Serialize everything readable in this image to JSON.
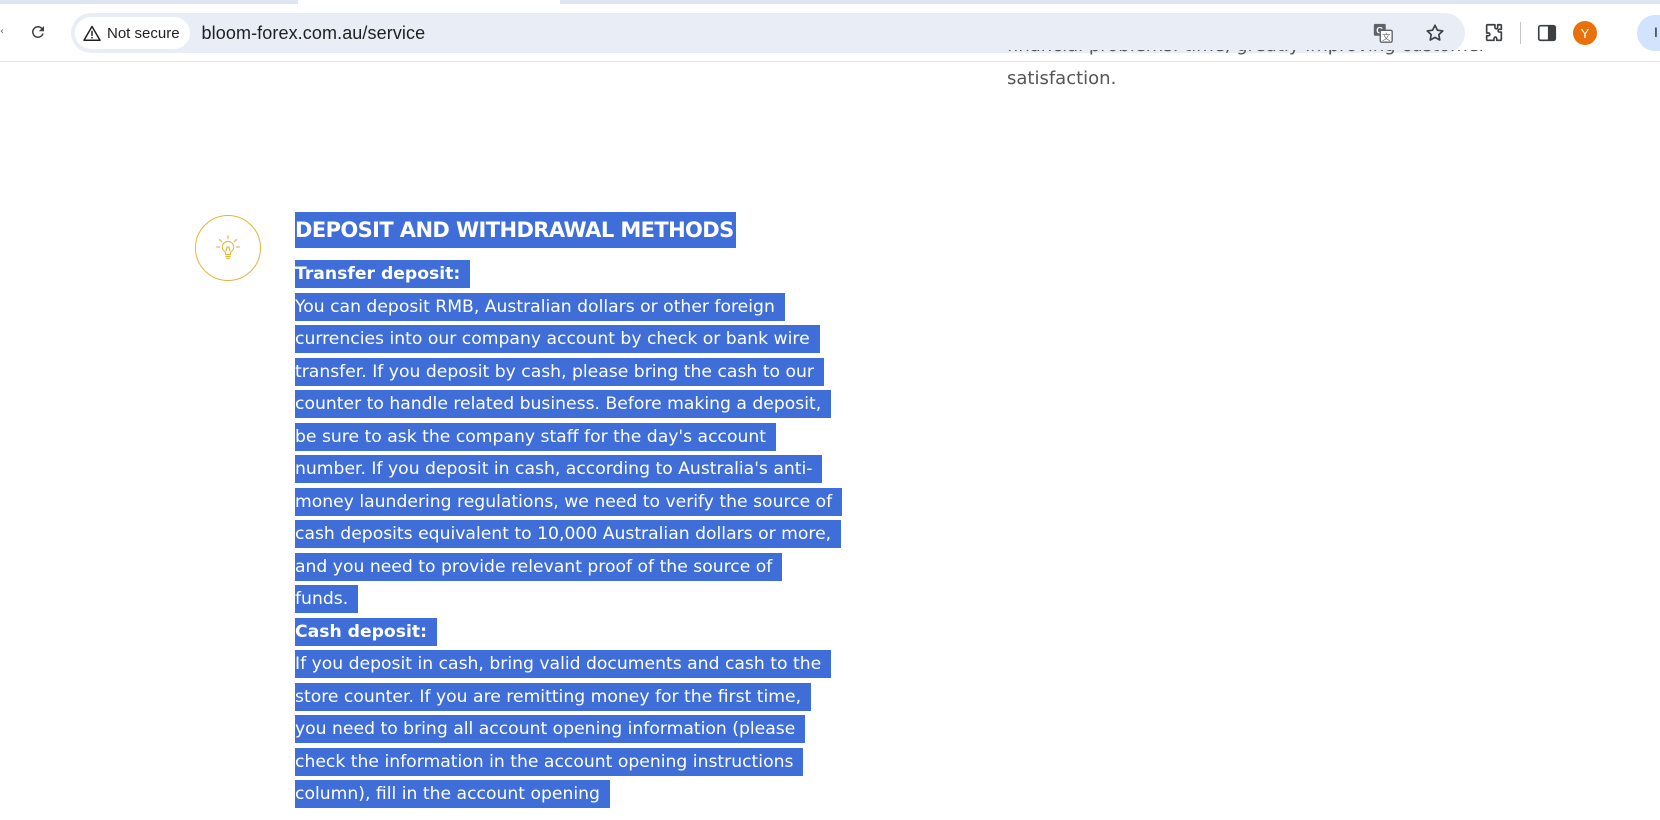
{
  "browser": {
    "security_label": "Not secure",
    "url": "bloom-forex.com.au/service",
    "profile_initial": "Y",
    "profile_pill_text": "I"
  },
  "page": {
    "previous_text": {
      "line1_partial": "financial problems. time, greatly improving customer",
      "line2": "satisfaction."
    },
    "section": {
      "title": "DEPOSIT AND WITHDRAWAL METHODS",
      "transfer_heading": "Transfer deposit:",
      "transfer_body": "You can deposit RMB, Australian dollars or other foreign currencies into our company account by check or bank wire transfer. If you deposit by cash, please bring the cash to our counter to handle related business. Before making a deposit, be sure to ask the company staff for the day's account number. If you deposit in cash, according to Australia's anti-money laundering regulations, we need to verify the source of cash deposits equivalent to 10,000 Australian dollars or more, and you need to provide relevant proof of the source of funds.",
      "cash_heading": "Cash deposit:",
      "cash_body": "If you deposit in cash, bring valid documents and cash to the store counter. If you are remitting money for the first time, you need to bring all account opening information (please check the information in the account opening instructions column), fill in the account opening"
    }
  },
  "colors": {
    "selection": "#3f6ed8",
    "icon_gold": "#e2b53a",
    "omnibox": "#e9eef6",
    "avatar": "#e8710a"
  },
  "icons": [
    "reload-icon",
    "warning-icon",
    "translate-icon",
    "star-icon",
    "extensions-icon",
    "side-panel-icon",
    "lightbulb-icon"
  ]
}
